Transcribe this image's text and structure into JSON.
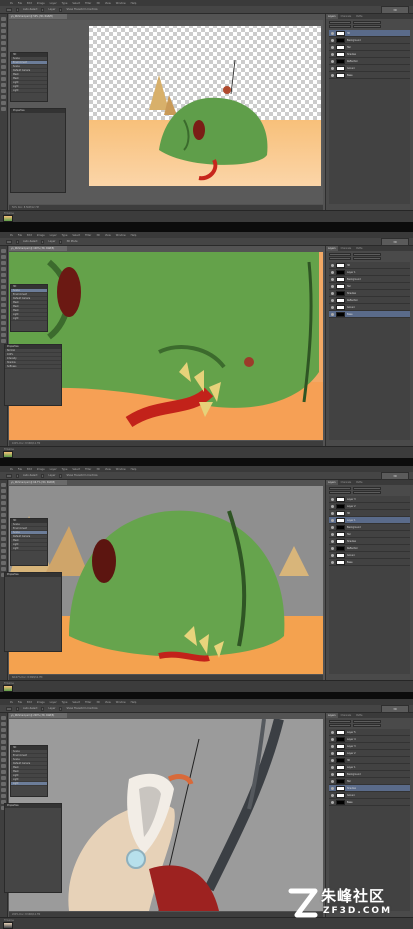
{
  "app": {
    "menu_items": [
      "Ps",
      "File",
      "Edit",
      "Image",
      "Layer",
      "Type",
      "Select",
      "Filter",
      "3D",
      "View",
      "Window",
      "Help"
    ],
    "workspace": "3D"
  },
  "accent": "#5a6b8a",
  "panels": [
    {
      "doc_tab": "ys_Mohmed.psd @ 50% (3D, RGB/8)",
      "status": "50%  Doc: 8.56M/12.7M",
      "options": [
        "Auto-Select",
        "Layer",
        "Show Transform Controls"
      ],
      "right_tabs": [
        "Layers",
        "Channels",
        "Paths"
      ],
      "layers": [
        "3D",
        "Background",
        "Tail",
        "Shadow",
        "Reflection",
        "Ground",
        "Base"
      ],
      "selected_layer": 0,
      "float": {
        "title": "3D",
        "items": [
          "Scene",
          "Environment",
          "Scene",
          "Default Camera",
          "Mesh",
          "Mesh",
          "Light",
          "Light",
          "Light"
        ],
        "selected": 1
      },
      "props": {
        "title": "Properties"
      }
    },
    {
      "doc_tab": "ys_Mohmed.psd @ 100% (3D, RGB/8)",
      "status": "100%  Doc: 8.56M/12.7M",
      "options": [
        "Auto-Select",
        "Layer",
        "3D Mode"
      ],
      "right_tabs": [
        "Layers",
        "Channels",
        "Paths"
      ],
      "layers": [
        "3D",
        "Layer 1",
        "Background",
        "Tail",
        "Shadow",
        "Reflection",
        "Ground",
        "Base"
      ],
      "selected_layer": 7,
      "float": {
        "title": "3D",
        "items": [
          "Scene",
          "Environment",
          "Default Camera",
          "Mesh",
          "Mesh",
          "Mesh",
          "Light",
          "Light"
        ],
        "selected": 0
      },
      "props": {
        "title": "Properties",
        "items": [
          "Normal",
          "100%",
          "Intensity",
          "Shadow",
          "Softness"
        ]
      }
    },
    {
      "doc_tab": "ys_Mohmed.psd @ 66.7% (3D, RGB/8)",
      "status": "66.67%  Doc: 8.56M/12.7M",
      "options": [
        "Auto-Select",
        "Layer",
        "Show Transform Controls"
      ],
      "right_tabs": [
        "Layers",
        "Channels",
        "Paths"
      ],
      "layers": [
        "Layer 3",
        "Layer 2",
        "3D",
        "Layer 1",
        "Background",
        "Tail",
        "Shadow",
        "Reflection",
        "Ground",
        "Base"
      ],
      "selected_layer": 3,
      "float": {
        "title": "3D",
        "items": [
          "Scene",
          "Environment",
          "Scene",
          "Default Camera",
          "Mesh",
          "Light",
          "Light"
        ],
        "selected": 2
      },
      "props": {
        "title": "Properties"
      }
    },
    {
      "doc_tab": "ys_Mohmed.psd @ 200% (3D, RGB/8)",
      "status": "200%  Doc: 8.56M/12.7M",
      "options": [
        "Auto-Select",
        "Layer",
        "Show Transform Controls"
      ],
      "right_tabs": [
        "Layers",
        "Channels",
        "Paths"
      ],
      "layers": [
        "Layer 5",
        "Layer 4",
        "Layer 3",
        "Layer 2",
        "3D",
        "Layer 1",
        "Background",
        "Tail",
        "Shadow",
        "Ground",
        "Base"
      ],
      "selected_layer": 8,
      "float": {
        "title": "3D",
        "items": [
          "Scene",
          "Environment",
          "Scene",
          "Default Camera",
          "Mesh",
          "Mesh",
          "Light",
          "Light",
          "Light"
        ],
        "selected": 8
      },
      "props": {
        "title": "Properties"
      }
    }
  ],
  "watermark": {
    "cn": "朱峰社区",
    "en": "ZF3D.COM"
  }
}
